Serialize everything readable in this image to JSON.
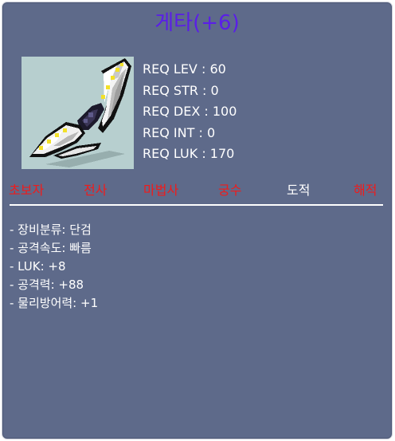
{
  "item": {
    "name": "게타(+6)",
    "name_color": "#5a1ee8",
    "icon": "dagger-icon"
  },
  "requirements": [
    {
      "label": "REQ LEV",
      "value": "60"
    },
    {
      "label": "REQ STR",
      "value": "0"
    },
    {
      "label": "REQ DEX",
      "value": "100"
    },
    {
      "label": "REQ INT",
      "value": "0"
    },
    {
      "label": "REQ LUK",
      "value": "170"
    }
  ],
  "jobs": [
    {
      "label": "초보자",
      "allowed": false
    },
    {
      "label": "전사",
      "allowed": false
    },
    {
      "label": "마법사",
      "allowed": false
    },
    {
      "label": "궁수",
      "allowed": false
    },
    {
      "label": "도적",
      "allowed": true
    },
    {
      "label": "해적",
      "allowed": false
    }
  ],
  "stats": [
    {
      "text": "- 장비분류: 단검"
    },
    {
      "text": "- 공격속도: 빠름"
    },
    {
      "text": "- LUK: +8"
    },
    {
      "text": "- 공격력: +88"
    },
    {
      "text": "- 물리방어력: +1"
    }
  ],
  "colors": {
    "panel": "#5e6a8a",
    "job_disallowed": "#f01b1b",
    "job_allowed": "#ffffff",
    "icon_background": "#b7cfcf"
  }
}
